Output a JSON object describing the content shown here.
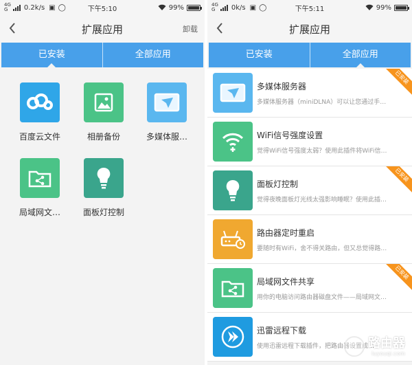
{
  "colors": {
    "tab_bar": "#48a0ea",
    "ribbon": "#f7941d",
    "tile_cyan": "#2fa6e8",
    "tile_green": "#4bc387",
    "tile_lightblue": "#5ab7ef",
    "tile_teal": "#3aa58c",
    "tile_orange": "#f0a830",
    "tile_blue": "#1f9be0"
  },
  "left": {
    "status": {
      "net": "4G",
      "net2": "G",
      "speed": "0.2k/s",
      "time": "下午5:10",
      "battery": "99%"
    },
    "appbar": {
      "title": "扩展应用",
      "action": "卸载"
    },
    "tabs": [
      "已安装",
      "全部应用"
    ],
    "installed": [
      {
        "label": "百度云文件",
        "icon": "baidu-cloud-icon",
        "color": "#2fa6e8"
      },
      {
        "label": "相册备份",
        "icon": "photo-album-icon",
        "color": "#4bc387"
      },
      {
        "label": "多媒体服…",
        "icon": "paper-plane-screen-icon",
        "color": "#5ab7ef"
      },
      {
        "label": "局域网文…",
        "icon": "share-folder-icon",
        "color": "#4bc387"
      },
      {
        "label": "面板灯控制",
        "icon": "light-bulb-icon",
        "color": "#3aa58c"
      }
    ]
  },
  "right": {
    "status": {
      "net": "4G",
      "net2": "G",
      "speed": "0k/s",
      "time": "下午5:11",
      "battery": "99%"
    },
    "appbar": {
      "title": "扩展应用"
    },
    "tabs": [
      "已安装",
      "全部应用"
    ],
    "badge": "已安装",
    "apps": [
      {
        "title": "多媒体服务器",
        "desc": "多媒体服务器（miniDLNA）可以让您通过手…",
        "icon": "paper-plane-screen-icon",
        "color": "#5ab7ef",
        "installed": true
      },
      {
        "title": "WiFi信号强度设置",
        "desc": "觉得WiFi信号强度太弱？使用此插件将WiFi信…",
        "icon": "wifi-plus-icon",
        "color": "#4bc387",
        "installed": false
      },
      {
        "title": "面板灯控制",
        "desc": "觉得夜晚面板灯光线太强影响睡眠？使用此插…",
        "icon": "light-bulb-icon",
        "color": "#3aa58c",
        "installed": true
      },
      {
        "title": "路由器定时重启",
        "desc": "要随时有WiFi，舍不得关路由，但又总觉得路…",
        "icon": "router-clock-icon",
        "color": "#f0a830",
        "installed": false
      },
      {
        "title": "局域网文件共享",
        "desc": "用你的电脑访问路由器磁盘文件——局域网文…",
        "icon": "share-folder-icon",
        "color": "#4bc387",
        "installed": true
      },
      {
        "title": "迅雷远程下载",
        "desc": "使用迅雷远程下载插件，把路由器设置成…",
        "icon": "xunlei-arrow-icon",
        "color": "#1f9be0",
        "installed": false
      }
    ]
  },
  "watermark": {
    "cn": "路由器",
    "en": "luyouqi.com"
  }
}
